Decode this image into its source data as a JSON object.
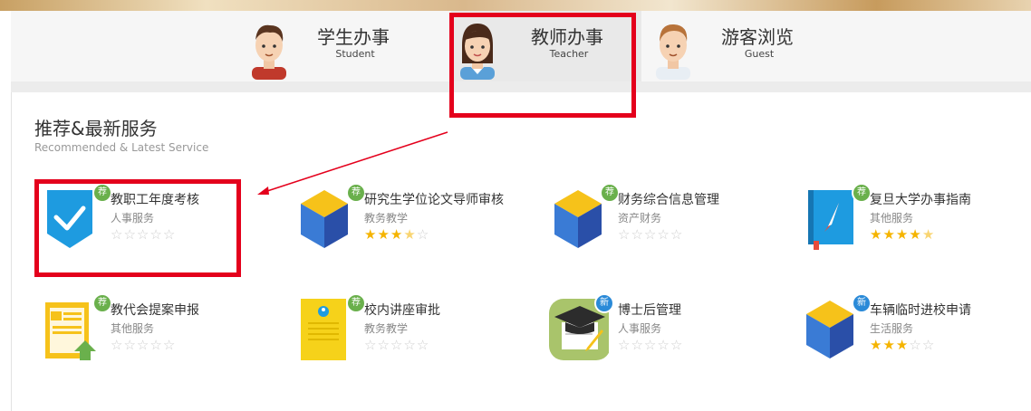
{
  "tabs": [
    {
      "title": "学生办事",
      "sub": "Student"
    },
    {
      "title": "教师办事",
      "sub": "Teacher"
    },
    {
      "title": "游客浏览",
      "sub": "Guest"
    }
  ],
  "section": {
    "title": "推荐&最新服务",
    "subtitle": "Recommended & Latest Service"
  },
  "services": [
    {
      "name": "教职工年度考核",
      "category": "人事服务",
      "badge": "荐",
      "rating": 0,
      "icon": "checkmark-shield-icon"
    },
    {
      "name": "研究生学位论文导师审核",
      "category": "教务教学",
      "badge": "荐",
      "rating": 3.5,
      "icon": "cube-icon"
    },
    {
      "name": "财务综合信息管理",
      "category": "资产财务",
      "badge": "荐",
      "rating": 0,
      "icon": "cube-icon"
    },
    {
      "name": "复旦大学办事指南",
      "category": "其他服务",
      "badge": "荐",
      "rating": 4.5,
      "icon": "compass-book-icon"
    },
    {
      "name": "教代会提案申报",
      "category": "其他服务",
      "badge": "荐",
      "rating": 0,
      "icon": "clipboard-upload-icon"
    },
    {
      "name": "校内讲座审批",
      "category": "教务教学",
      "badge": "荐",
      "rating": 0,
      "icon": "person-card-icon"
    },
    {
      "name": "博士后管理",
      "category": "人事服务",
      "badge": "新",
      "rating": 0,
      "icon": "graduation-cap-icon"
    },
    {
      "name": "车辆临时进校申请",
      "category": "生活服务",
      "badge": "新",
      "rating": 3,
      "icon": "cube-icon"
    }
  ],
  "colors": {
    "highlight": "#e4001c",
    "star": "#f5b400",
    "badge_recommend": "#6ab04c",
    "badge_new": "#2a8ad8"
  }
}
